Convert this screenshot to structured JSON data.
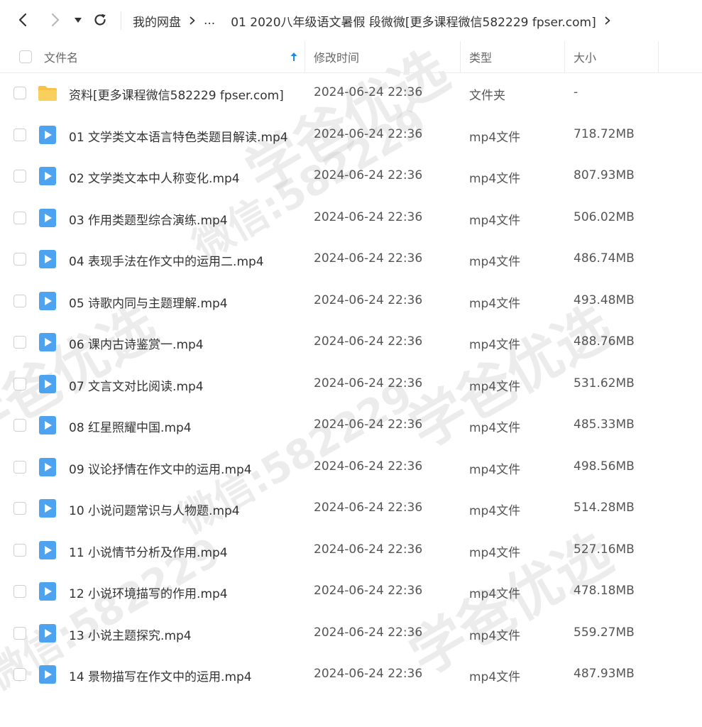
{
  "toolbar": {
    "back_label": "<",
    "forward_label": ">",
    "breadcrumb": {
      "root": "我的网盘",
      "ellipsis": "...",
      "current": "01 2020八年级语文暑假 段微微[更多课程微信582229 fpser.com]"
    }
  },
  "columns": {
    "name": "文件名",
    "modified": "修改时间",
    "type": "类型",
    "size": "大小"
  },
  "files": [
    {
      "name": "资料[更多课程微信582229 fpser.com]",
      "modified": "2024-06-24 22:36",
      "type": "文件夹",
      "size": "-",
      "icon": "folder-icon"
    },
    {
      "name": "01 文学类文本语言特色类题目解读.mp4",
      "modified": "2024-06-24 22:36",
      "type": "mp4文件",
      "size": "718.72MB",
      "icon": "video-file-icon"
    },
    {
      "name": "02 文学类文本中人称变化.mp4",
      "modified": "2024-06-24 22:36",
      "type": "mp4文件",
      "size": "807.93MB",
      "icon": "video-file-icon"
    },
    {
      "name": "03 作用类题型综合演练.mp4",
      "modified": "2024-06-24 22:36",
      "type": "mp4文件",
      "size": "506.02MB",
      "icon": "video-file-icon"
    },
    {
      "name": "04 表现手法在作文中的运用二.mp4",
      "modified": "2024-06-24 22:36",
      "type": "mp4文件",
      "size": "486.74MB",
      "icon": "video-file-icon"
    },
    {
      "name": "05 诗歌内同与主题理解.mp4",
      "modified": "2024-06-24 22:36",
      "type": "mp4文件",
      "size": "493.48MB",
      "icon": "video-file-icon"
    },
    {
      "name": "06 课内古诗鉴赏一.mp4",
      "modified": "2024-06-24 22:36",
      "type": "mp4文件",
      "size": "488.76MB",
      "icon": "video-file-icon"
    },
    {
      "name": "07 文言文对比阅读.mp4",
      "modified": "2024-06-24 22:36",
      "type": "mp4文件",
      "size": "531.62MB",
      "icon": "video-file-icon"
    },
    {
      "name": "08 红星照耀中国.mp4",
      "modified": "2024-06-24 22:36",
      "type": "mp4文件",
      "size": "485.33MB",
      "icon": "video-file-icon"
    },
    {
      "name": "09 议论抒情在作文中的运用.mp4",
      "modified": "2024-06-24 22:36",
      "type": "mp4文件",
      "size": "498.56MB",
      "icon": "video-file-icon"
    },
    {
      "name": "10 小说问题常识与人物题.mp4",
      "modified": "2024-06-24 22:36",
      "type": "mp4文件",
      "size": "514.28MB",
      "icon": "video-file-icon"
    },
    {
      "name": "11 小说情节分析及作用.mp4",
      "modified": "2024-06-24 22:36",
      "type": "mp4文件",
      "size": "527.16MB",
      "icon": "video-file-icon"
    },
    {
      "name": "12 小说环境描写的作用.mp4",
      "modified": "2024-06-24 22:36",
      "type": "mp4文件",
      "size": "478.18MB",
      "icon": "video-file-icon"
    },
    {
      "name": "13 小说主题探究.mp4",
      "modified": "2024-06-24 22:36",
      "type": "mp4文件",
      "size": "559.27MB",
      "icon": "video-file-icon"
    },
    {
      "name": "14 景物描写在作文中的运用.mp4",
      "modified": "2024-06-24 22:36",
      "type": "mp4文件",
      "size": "487.93MB",
      "icon": "video-file-icon"
    }
  ],
  "watermark": {
    "text": "学爸优选",
    "wechat": "微信:582229"
  },
  "colors": {
    "accent": "#1e88e5",
    "video_icon": "#4da3ef",
    "folder_icon": "#f7c248"
  }
}
